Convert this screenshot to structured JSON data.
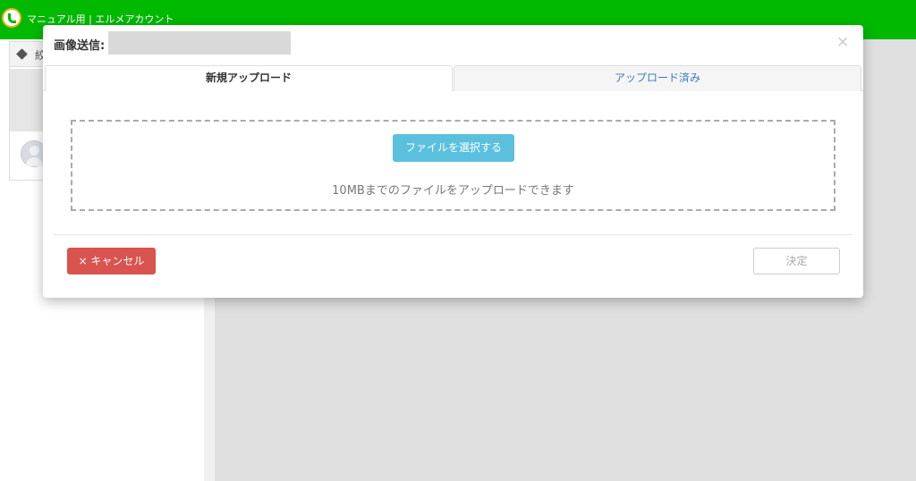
{
  "app": {
    "title": "マニュアル用 | エルメアカウント"
  },
  "sidebar": {
    "label": "絞"
  },
  "modal": {
    "title": "画像送信:",
    "close_icon": "×",
    "tabs": [
      {
        "label": "新規アップロード",
        "active": true
      },
      {
        "label": "アップロード済み",
        "active": false
      }
    ],
    "dropzone": {
      "select_button": "ファイルを選択する",
      "hint": "10MBまでのファイルをアップロードできます"
    },
    "footer": {
      "cancel_label": "× キャンセル",
      "confirm_label": "決定"
    }
  },
  "colors": {
    "brand_green": "#00b900",
    "info_blue": "#5bc0de",
    "danger_red": "#d9534f",
    "link_blue": "#3a7bbf"
  },
  "icons": {
    "logo": "app-logo",
    "tag": "tag-icon",
    "avatar": "user-avatar-icon",
    "close": "close-icon"
  }
}
